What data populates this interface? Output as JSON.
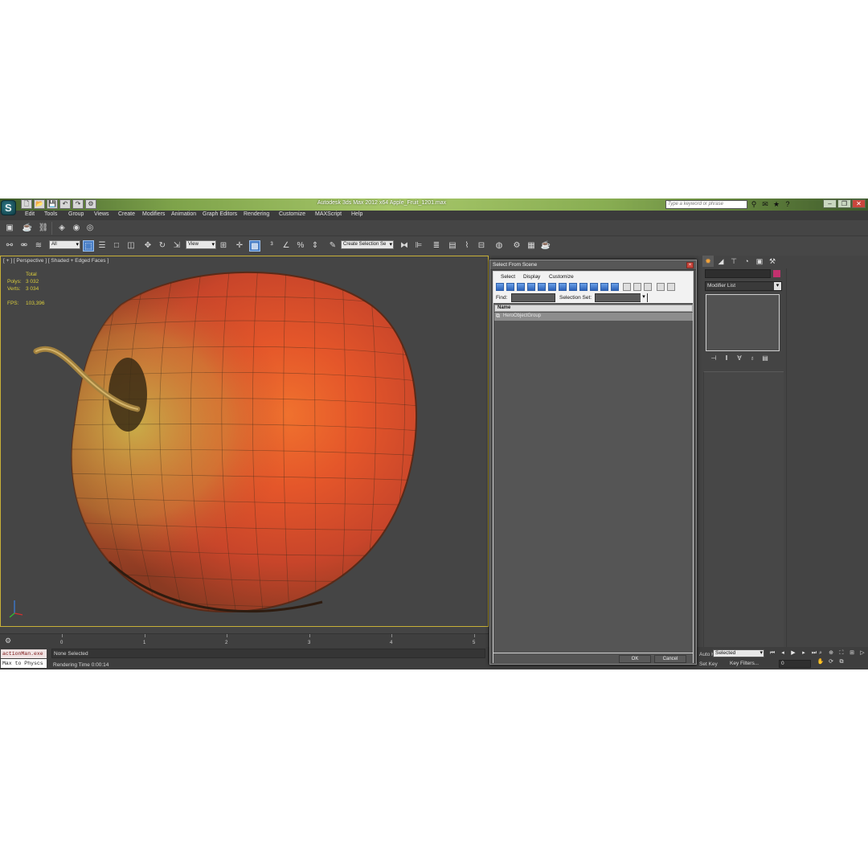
{
  "app": {
    "logo_letter": "S",
    "title": "Autodesk 3ds Max 2012 x64    Apple_Fruit_1201.max",
    "search_placeholder": "Type a keyword or phrase",
    "window_controls": [
      "–",
      "❐",
      "✕"
    ]
  },
  "quick_access": [
    "🗋",
    "📂",
    "💾",
    "↶",
    "↷",
    "⚙"
  ],
  "menu": [
    "Edit",
    "Tools",
    "Group",
    "Views",
    "Create",
    "Modifiers",
    "Animation",
    "Graph Editors",
    "Rendering",
    "Customize",
    "MAXScript",
    "Help"
  ],
  "toolbar": {
    "selection_filter": "All",
    "ref_coord": "View",
    "named_selection": "Create Selection Se"
  },
  "viewport": {
    "label": "[ + ] [ Perspective ] [ Shaded + Edged Faces ]",
    "stats_header": "Total",
    "polys_label": "Polys:",
    "polys_value": "3 032",
    "verts_label": "Verts:",
    "verts_value": "3 034",
    "fps_label": "FPS:",
    "fps_value": "103,396"
  },
  "command_panel": {
    "modifier_list": "Modifier List",
    "name_swatch_color": "#c2316e"
  },
  "timeline": {
    "ticks": [
      "0",
      "1",
      "2",
      "3",
      "4",
      "5"
    ]
  },
  "status": {
    "listener_top": "actionMan.exe",
    "listener_bottom": "Max to Physcs",
    "selection_status": "None Selected",
    "render_time": "Rendering Time  0:00:14",
    "set_key_label": "Set Key",
    "auto_key_label": "Auto Key",
    "key_mode": "Selected",
    "key_filters": "Key Filters...",
    "frame": "0"
  },
  "dialog": {
    "title": "Select From Scene",
    "menu": [
      "Select",
      "Display",
      "Customize"
    ],
    "find_label": "Find:",
    "selection_set_label": "Selection Set:",
    "column_header": "Name",
    "rows": [
      {
        "name": "HeroObjectGroup"
      }
    ],
    "ok": "OK",
    "cancel": "Cancel"
  }
}
